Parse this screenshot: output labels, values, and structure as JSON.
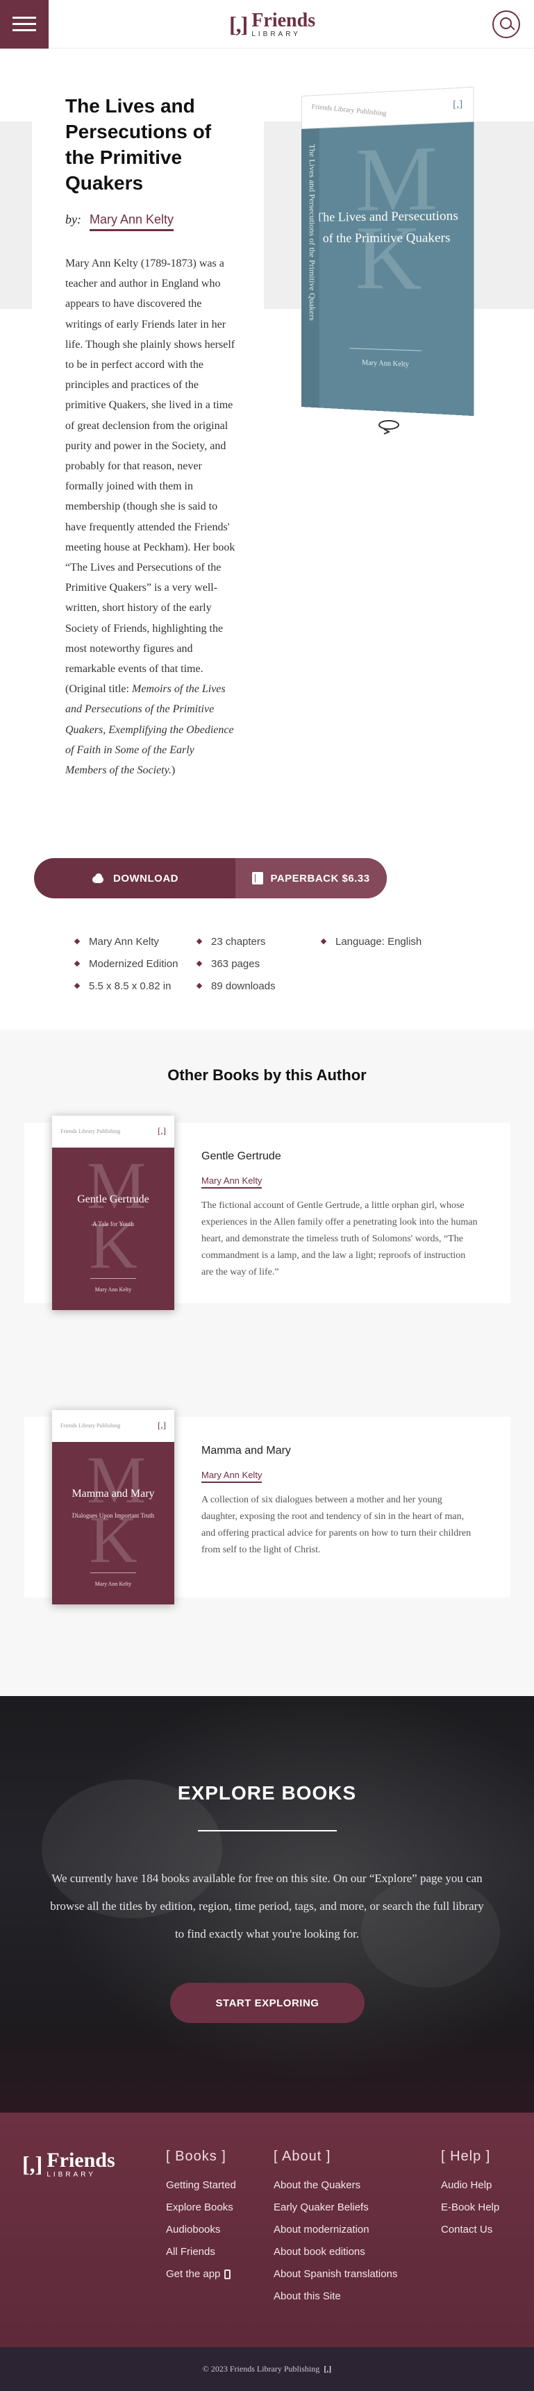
{
  "header": {
    "logo_bracket": "[,]",
    "logo_word": "Friends",
    "logo_sub": "LIBRARY"
  },
  "book": {
    "title": "The Lives and Persecutions of the Primitive Quakers",
    "by": "by:",
    "author": "Mary Ann Kelty",
    "description": "Mary Ann Kelty (1789-1873) was a teacher and author in England who appears to have discovered the writings of early Friends later in her life. Though she plainly shows herself to be in perfect accord with the principles and practices of the primitive Quakers, she lived in a time of great declension from the original purity and power in the Society, and probably for that reason, never formally joined with them in membership (though she is said to have frequently attended the Friends' meeting house at Peckham). Her book “The Lives and Persecutions of the Primitive Quakers” is a very well-written, short history of the early Society of Friends, highlighting the most noteworthy figures and remarkable events of that time.",
    "original_prefix": "(Original title: ",
    "original_title": "Memoirs of the Lives and Persecutions of the Primitive Quakers, Exemplifying the Obedience of Faith in Some of the Early Members of the Society.",
    "original_suffix": ")"
  },
  "cover": {
    "publisher": "Friends Library Publishing",
    "monogram_top": "M",
    "monogram_bottom": "K",
    "title": "The Lives and Persecutions of the Primitive Quakers",
    "author": "Mary Ann Kelty",
    "spine_text": "The Lives and Persecutions of the Primitive Quakers",
    "color": "#5f8797"
  },
  "actions": {
    "download": "DOWNLOAD",
    "paperback": "PAPERBACK $6.33"
  },
  "meta": {
    "col1": [
      "Mary Ann Kelty",
      "Modernized Edition",
      "5.5 x 8.5 x 0.82 in"
    ],
    "col2": [
      "23 chapters",
      "363 pages",
      "89 downloads"
    ],
    "col3": [
      "Language: English"
    ]
  },
  "others": {
    "heading": "Other Books by this Author",
    "books": [
      {
        "title": "Gentle Gertrude",
        "author": "Mary Ann Kelty",
        "description": "The fictional account of Gentle Gertrude, a little orphan girl, whose experiences in the Allen family offer a penetrating look into the human heart, and demonstrate the timeless truth of Solomons' words, “The commandment is a lamp, and the law a light; reproofs of instruction are the way of life.”",
        "cover_title": "Gentle Gertrude",
        "cover_subtitle": "A Tale for Youth",
        "cover_author": "Mary Ann Kelty"
      },
      {
        "title": "Mamma and Mary",
        "author": "Mary Ann Kelty",
        "description": "A collection of six dialogues between a mother and her young daughter, exposing the root and tendency of sin in the heart of man, and offering practical advice for parents on how to turn their children from self to the light of Christ.",
        "cover_title": "Mamma and Mary",
        "cover_subtitle": "Dialogues Upon Important Truth",
        "cover_author": "Mary Ann Kelty"
      }
    ]
  },
  "explore": {
    "title": "EXPLORE BOOKS",
    "text": "We currently have 184 books available for free on this site. On our “Explore” page you can browse all the titles by edition, region, time period, tags, and more, or search the full library to find exactly what you're looking for.",
    "button": "START EXPLORING"
  },
  "footer": {
    "books": {
      "heading": "[ Books ]",
      "links": [
        "Getting Started",
        "Explore Books",
        "Audiobooks",
        "All Friends",
        "Get the app"
      ]
    },
    "about": {
      "heading": "[ About ]",
      "links": [
        "About the Quakers",
        "Early Quaker Beliefs",
        "About modernization",
        "About book editions",
        "About Spanish translations",
        "About this Site"
      ]
    },
    "help": {
      "heading": "[ Help ]",
      "links": [
        "Audio Help",
        "E-Book Help",
        "Contact Us"
      ]
    },
    "copyright": "© 2023 Friends Library Publishing",
    "copyright_mark": "[,]"
  },
  "colors": {
    "brand": "#6c3142",
    "brand_light": "#84495b",
    "cover_blue": "#5f8797"
  }
}
